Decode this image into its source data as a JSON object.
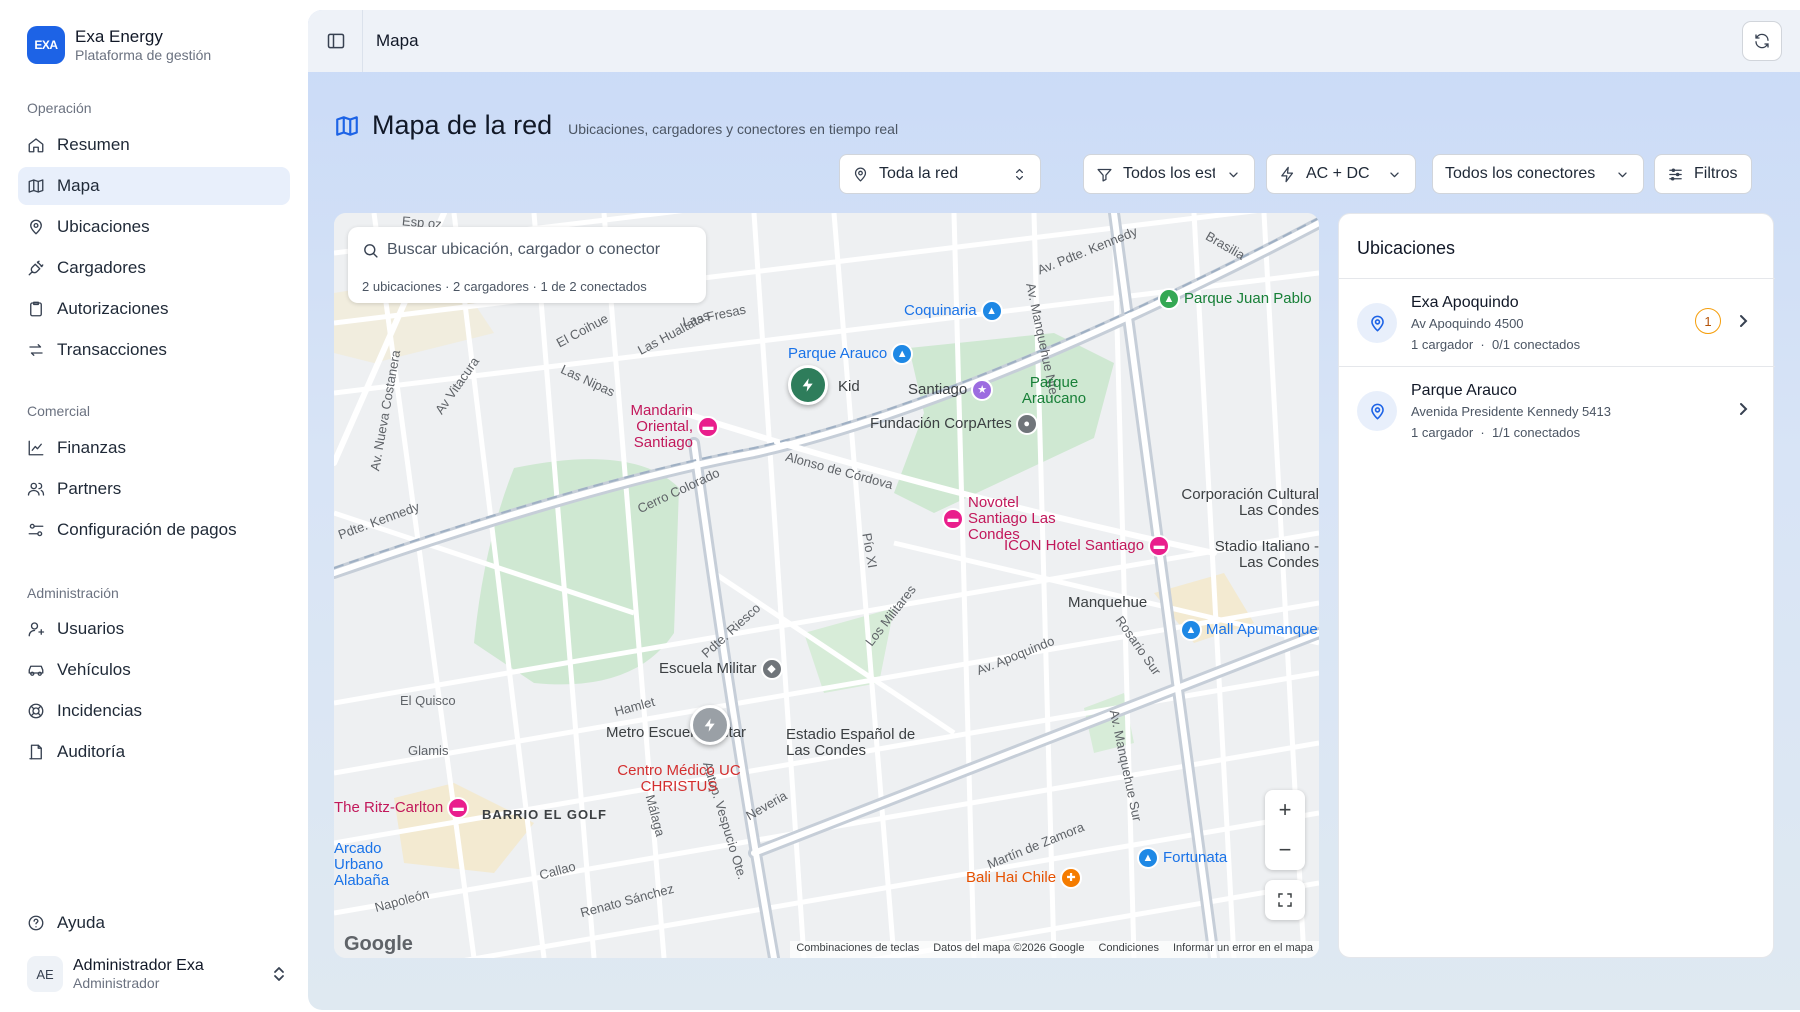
{
  "brand": {
    "name": "Exa Energy",
    "subtitle": "Plataforma de gestión",
    "logo_text": "EXA"
  },
  "sidebar": {
    "sections": [
      {
        "title": "Operación",
        "items": [
          {
            "label": "Resumen",
            "icon": "home-icon"
          },
          {
            "label": "Mapa",
            "icon": "map-icon",
            "active": true
          },
          {
            "label": "Ubicaciones",
            "icon": "pin-icon"
          },
          {
            "label": "Cargadores",
            "icon": "plug-icon"
          },
          {
            "label": "Autorizaciones",
            "icon": "clipboard-icon"
          },
          {
            "label": "Transacciones",
            "icon": "arrows-icon"
          }
        ]
      },
      {
        "title": "Comercial",
        "items": [
          {
            "label": "Finanzas",
            "icon": "chart-line-icon"
          },
          {
            "label": "Partners",
            "icon": "users-icon"
          },
          {
            "label": "Configuración de pagos",
            "icon": "sliders-icon"
          }
        ]
      },
      {
        "title": "Administración",
        "items": [
          {
            "label": "Usuarios",
            "icon": "user-icon"
          },
          {
            "label": "Vehículos",
            "icon": "car-icon"
          },
          {
            "label": "Incidencias",
            "icon": "lifebuoy-icon"
          },
          {
            "label": "Auditoría",
            "icon": "audit-icon"
          }
        ]
      }
    ],
    "help_label": "Ayuda",
    "user": {
      "initials": "AE",
      "name": "Administrador Exa",
      "role": "Administrador"
    }
  },
  "topbar": {
    "breadcrumb": "Mapa"
  },
  "page": {
    "title": "Mapa de la red",
    "subtitle": "Ubicaciones, cargadores y conectores en tiempo real"
  },
  "filters": {
    "network": "Toda la red",
    "status": "Todos los estad",
    "current": "AC + DC",
    "connectors": "Todos los conectores",
    "more": "Filtros"
  },
  "map": {
    "search_placeholder": "Buscar ubicación, cargador o conector",
    "search_meta": "2 ubicaciones · 2 cargadores · 1 de 2 conectados",
    "zoom_in": "+",
    "zoom_out": "−",
    "google": "Google",
    "attribution": [
      "Combinaciones de teclas",
      "Datos del mapa ©2026 Google",
      "Condiciones",
      "Informar un error en el mapa"
    ],
    "streets": [
      "Av. Pdte. Kennedy",
      "Las Hualtatas",
      "Alonso de Córdova",
      "Av Vitacura",
      "Pdte. Kennedy",
      "Av. Apoquindo",
      "Los Militares",
      "Pdte. Riesco",
      "Av. Manquehue Nte.",
      "Av. Manquehue Sur",
      "Autop. Vespucio Ote.",
      "BARRIO EL GOLF",
      "Cerro Colorado",
      "Av. Nueva Costanera",
      "El Quisco",
      "Hamlet",
      "Martín de Zamora",
      "Brasilia",
      "Las Fresas",
      "El Coihue",
      "Las Nipas",
      "Esp oz",
      "Pío XI",
      "Rosario Sur",
      "Glamis",
      "Napoleón",
      "Callao",
      "Renato Sánchez",
      "Málaga",
      "Neveria",
      "Apoquindo"
    ],
    "pois": [
      {
        "label": "Coquinaria",
        "color": "#1e88e5"
      },
      {
        "label": "Parque Arauco",
        "color": "#1e88e5"
      },
      {
        "label": "Kid",
        "color": "#3c4043"
      },
      {
        "label": "Santiago",
        "color": "#3c4043"
      },
      {
        "label": "Parque Araucano",
        "color": "#188038"
      },
      {
        "label": "Mandarin Oriental, Santiago",
        "color": "#c2185b"
      },
      {
        "label": "Fundación CorpArtes",
        "color": "#3c4043"
      },
      {
        "label": "Novotel Santiago Las Condes",
        "color": "#c2185b"
      },
      {
        "label": "ICON Hotel Santiago",
        "color": "#c2185b"
      },
      {
        "label": "Parque Juan Pablo",
        "color": "#188038"
      },
      {
        "label": "Corporación Cultural Las Condes",
        "color": "#3c4043"
      },
      {
        "label": "Stadio Italiano - Las Condes",
        "color": "#3c4043"
      },
      {
        "label": "Manquehue",
        "color": "#3c4043"
      },
      {
        "label": "Mall Apumanque",
        "color": "#1e88e5"
      },
      {
        "label": "Escuela Militar",
        "color": "#3c4043"
      },
      {
        "label": "Metro Escuela Militar",
        "color": "#3c4043"
      },
      {
        "label": "Estadio Español de Las Condes",
        "color": "#3c4043"
      },
      {
        "label": "Centro Médico UC CHRISTUS",
        "color": "#d32f2f"
      },
      {
        "label": "The Ritz-Carlton",
        "color": "#c2185b"
      },
      {
        "label": "Fortunata",
        "color": "#1e88e5"
      },
      {
        "label": "Bali Hai Chile",
        "color": "#e65100"
      },
      {
        "label": "Arcado Urbano Alabaña",
        "color": "#1e88e5"
      }
    ]
  },
  "locations": {
    "title": "Ubicaciones",
    "items": [
      {
        "name": "Exa Apoquindo",
        "address": "Av Apoquindo 4500",
        "chargers": "1 cargador",
        "connected": "0/1 conectados",
        "badge": "1"
      },
      {
        "name": "Parque Arauco",
        "address": "Avenida Presidente Kennedy 5413",
        "chargers": "1 cargador",
        "connected": "1/1 conectados"
      }
    ]
  },
  "colors": {
    "accent": "#1d63e6",
    "online_marker": "#2e7d5b",
    "offline_marker": "#9aa0a6",
    "badge_warning": "#f59e0b"
  }
}
